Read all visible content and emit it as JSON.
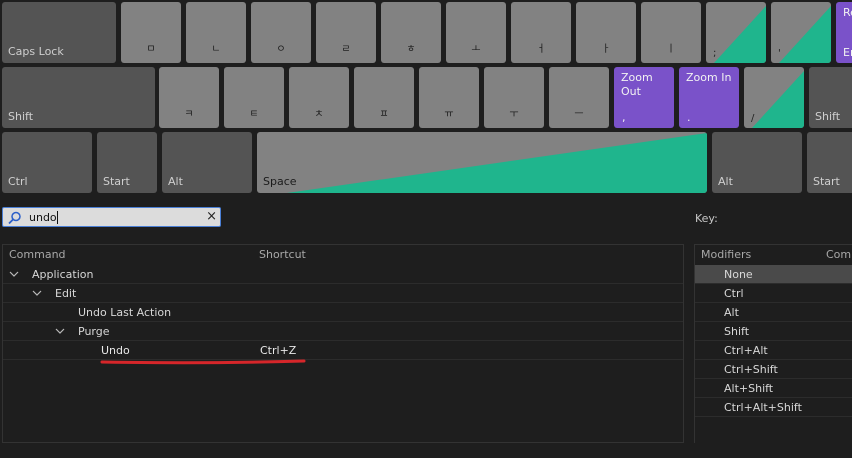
{
  "keyboard": {
    "row1": {
      "caps": "Caps Lock",
      "keys": [
        "ㅁ",
        "ㄴ",
        "ㅇ",
        "ㄹ",
        "ㅎ",
        "ㅗ",
        "ㅓ",
        "ㅏ",
        "ㅣ"
      ],
      "semicolon": ";",
      "quote": "'",
      "enter_top": "Re",
      "enter_bottom": "Er"
    },
    "row2": {
      "shift_left": "Shift",
      "keys": [
        "ㅋ",
        "ㅌ",
        "ㅊ",
        "ㅍ",
        "ㅠ",
        "ㅜ",
        "ㅡ"
      ],
      "zoom_out": "Zoom Out",
      "zoom_out_char": ",",
      "zoom_in": "Zoom In",
      "zoom_in_char": ".",
      "slash": "/",
      "shift_right": "Shift"
    },
    "row3": {
      "ctrl": "Ctrl",
      "start_left": "Start",
      "alt_left": "Alt",
      "space": "Space",
      "alt_right": "Alt",
      "start_right": "Start"
    },
    "colors": {
      "gray": "#828282",
      "dark": "#545454",
      "purple": "#7a52c9",
      "green": "#1fb58d"
    }
  },
  "search": {
    "value": "undo",
    "clear": "×",
    "icon": "search-icon"
  },
  "key_panel": {
    "label": "Key:"
  },
  "table": {
    "headers": {
      "command": "Command",
      "shortcut": "Shortcut"
    },
    "rows": [
      {
        "label": "Application",
        "shortcut": ""
      },
      {
        "label": "Edit",
        "shortcut": ""
      },
      {
        "label": "Undo Last Action",
        "shortcut": ""
      },
      {
        "label": "Purge",
        "shortcut": ""
      },
      {
        "label": "Undo",
        "shortcut": "Ctrl+Z"
      }
    ]
  },
  "modifiers": {
    "headers": {
      "modifiers": "Modifiers",
      "commands": "Comm"
    },
    "items": [
      "None",
      "Ctrl",
      "Alt",
      "Shift",
      "Ctrl+Alt",
      "Ctrl+Shift",
      "Alt+Shift",
      "Ctrl+Alt+Shift"
    ],
    "selected": "None"
  },
  "annotation": {
    "color": "#d6262a"
  }
}
